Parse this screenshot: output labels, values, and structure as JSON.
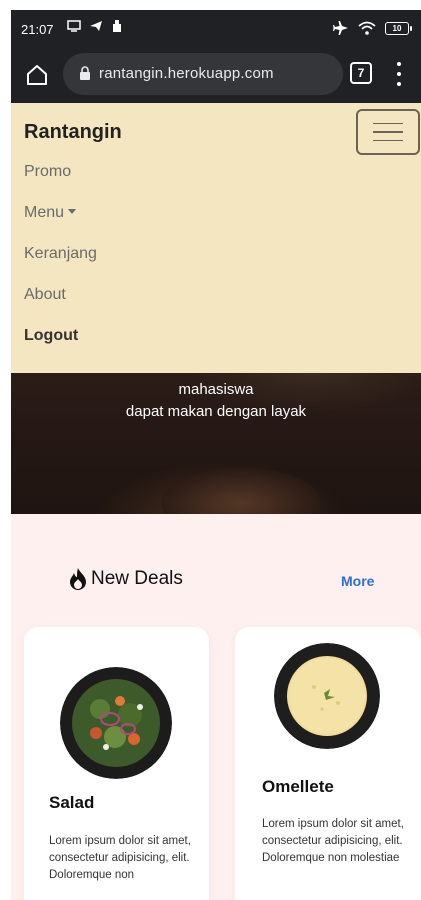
{
  "status_bar": {
    "time": "21:07",
    "battery": "10"
  },
  "browser": {
    "url": "rantangin.herokuapp.com",
    "tab_count": "7"
  },
  "navbar": {
    "brand": "Rantangin",
    "items": [
      {
        "label": "Promo"
      },
      {
        "label": "Menu"
      },
      {
        "label": "Keranjang"
      },
      {
        "label": "About"
      },
      {
        "label": "Logout"
      }
    ]
  },
  "hero": {
    "line1": "mahasiswa",
    "line2": "dapat makan dengan layak"
  },
  "deals": {
    "title": "New Deals",
    "more_label": "More",
    "icon": "fire-icon",
    "cards": [
      {
        "title": "Salad",
        "description": "Lorem ipsum dolor sit amet, consectetur adipisicing, elit. Doloremque non",
        "image": "salad-bowl-image"
      },
      {
        "title": "Omellete",
        "description": "Lorem ipsum dolor sit amet, consectetur adipisicing, elit. Doloremque non molestiae",
        "image": "omelette-plate-image"
      }
    ]
  },
  "colors": {
    "navbar_bg": "#f5e6c2",
    "deals_bg": "#fdf0ef",
    "link_blue": "#2b6fd6",
    "browser_bg": "#202124"
  }
}
